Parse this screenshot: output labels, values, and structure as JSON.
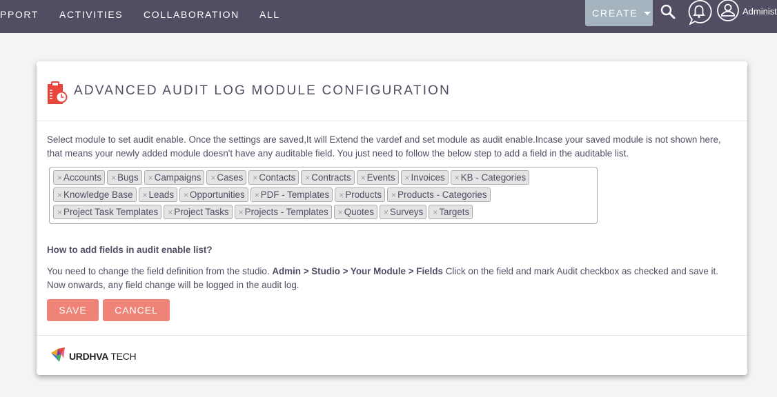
{
  "topnav": {
    "items": [
      "PPORT",
      "ACTIVITIES",
      "COLLABORATION",
      "ALL"
    ],
    "create_label": "CREATE",
    "user_name": "Administ",
    "icons": {
      "search": "search-icon",
      "notifications": "bell-icon",
      "user": "user-avatar-icon",
      "create_caret": "caret-down-icon"
    }
  },
  "panel": {
    "title": "ADVANCED AUDIT LOG MODULE CONFIGURATION",
    "title_icon": "clipboard-clock-icon",
    "description": "Select module to set audit enable. Once the settings are saved,It will Extend the vardef and set module as audit enable.Incase your saved module is not shown here, that means your newly added module doesn't have any auditable field. You just need to follow the below step to add a field in the auditable list.",
    "selected_modules": [
      "Accounts",
      "Bugs",
      "Campaigns",
      "Cases",
      "Contacts",
      "Contracts",
      "Events",
      "Invoices",
      "KB - Categories",
      "Knowledge Base",
      "Leads",
      "Opportunities",
      "PDF - Templates",
      "Products",
      "Products - Categories",
      "Project Task Templates",
      "Project Tasks",
      "Projects - Templates",
      "Quotes",
      "Surveys",
      "Targets"
    ],
    "tag_remove_symbol": "×",
    "howto_title": "How to add fields in audit enable list?",
    "howto_prefix": "You need to change the field definition from the studio. ",
    "howto_path": "Admin > Studio > Your Module > Fields",
    "howto_suffix": " Click on the field and mark Audit checkbox as checked and save it.",
    "howto_line2": "Now onwards, any field change will be logged in the audit log.",
    "save_label": "SAVE",
    "cancel_label": "CANCEL",
    "footer_brand_bold": "URDHVA",
    "footer_brand_rest": " TECH"
  },
  "colors": {
    "nav_bg": "#534d64",
    "create_bg": "#a5b3be",
    "button_bg": "#f08377",
    "icon_red": "#e8453c",
    "text": "#534d64"
  }
}
